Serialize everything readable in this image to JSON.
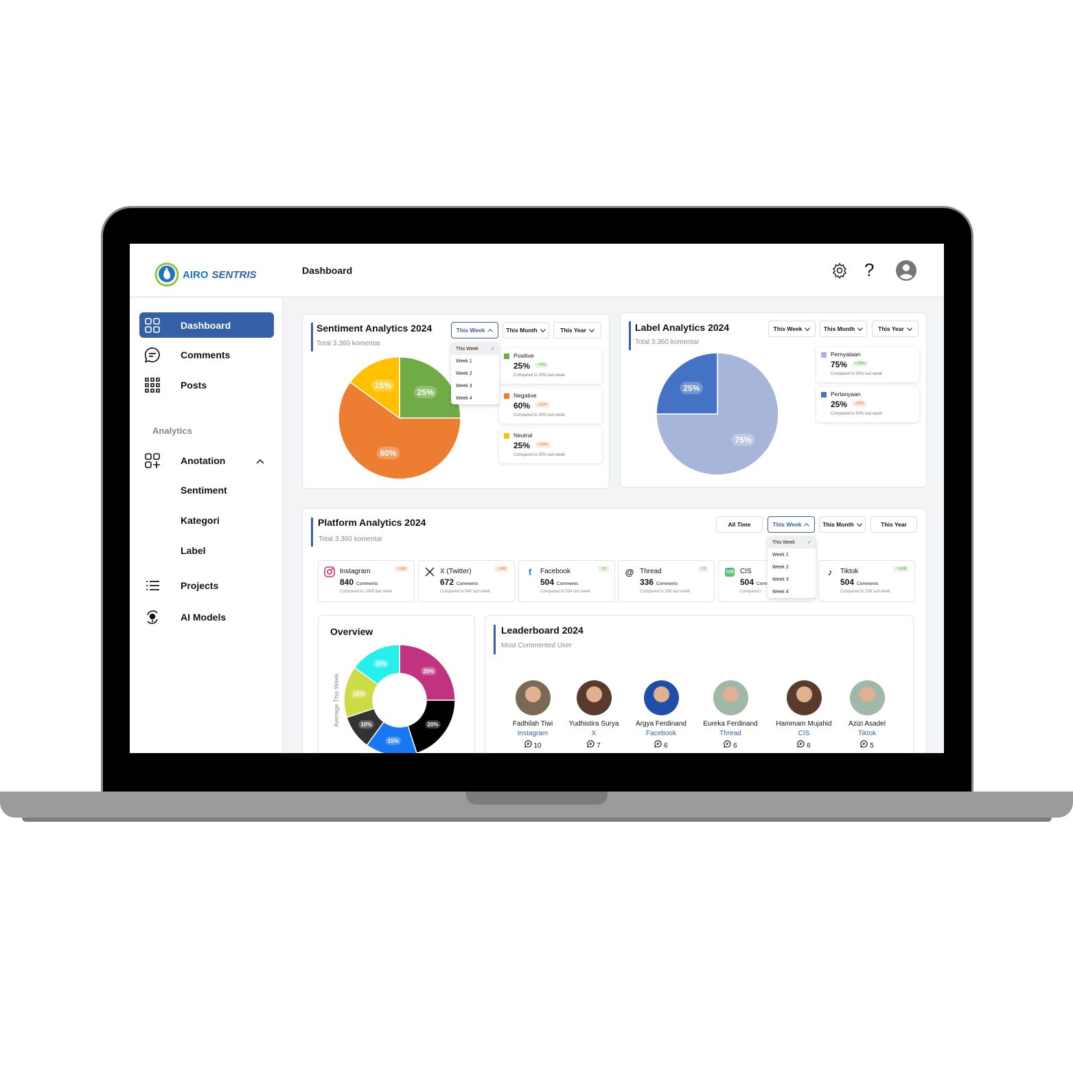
{
  "app": {
    "logo_text_1": "AIRO",
    "logo_text_2": "SENTRIS",
    "page_title": "Dashboard"
  },
  "header": {
    "icons": [
      "gear-icon",
      "help-icon",
      "user-avatar-icon"
    ],
    "help_glyph": "?"
  },
  "sidebar": {
    "items": [
      {
        "label": "Dashboard",
        "icon": "grid-icon",
        "active": true
      },
      {
        "label": "Comments",
        "icon": "chat-icon"
      },
      {
        "label": "Posts",
        "icon": "dots-grid-icon"
      }
    ],
    "section": "Analytics",
    "annotation": {
      "label": "Anotation",
      "icon": "grid-plus-icon",
      "expanded": true,
      "children": [
        "Sentiment",
        "Kategori",
        "Label"
      ]
    },
    "bottom": [
      {
        "label": "Projects",
        "icon": "list-icon"
      },
      {
        "label": "AI Models",
        "icon": "ai-model-icon"
      }
    ]
  },
  "colors": {
    "accent": "#355fa6",
    "positive": "#6fac46",
    "negative": "#ed7d31",
    "neutral": "#ffc000",
    "pernyataan": "#a8b5db",
    "pertanyaan": "#4472c4"
  },
  "sentiment": {
    "title": "Sentiment Analytics 2024",
    "subtitle": "Total 3.360 komentar",
    "filters": [
      "This Week",
      "This Month",
      "This Year"
    ],
    "dropdown": [
      "This Week",
      "Week 1",
      "Week 2",
      "Week 3",
      "Week 4"
    ],
    "check": "✓",
    "stats": [
      {
        "name": "Positive",
        "pct": "25%",
        "delta": "+5%",
        "trend": "up",
        "compare": "Compared to 20% last week"
      },
      {
        "name": "Negative",
        "pct": "60%",
        "delta": "-15%",
        "trend": "down",
        "compare": "Compared to 30% last week"
      },
      {
        "name": "Neutral",
        "pct": "25%",
        "delta": "+10%",
        "trend": "down",
        "compare": "Compared to 50% last week"
      }
    ]
  },
  "label": {
    "title": "Label Analytics 2024",
    "subtitle": "Total 3.360 komentar",
    "filters": [
      "This Week",
      "This Month",
      "This Year"
    ],
    "stats": [
      {
        "name": "Pernyataan",
        "pct": "75%",
        "delta": "+25%",
        "trend": "up",
        "compare": "Compared to 50% last week"
      },
      {
        "name": "Pertanyaan",
        "pct": "25%",
        "delta": "-25%",
        "trend": "down",
        "compare": "Compared to 50% last week"
      }
    ]
  },
  "platform": {
    "title": "Platform Analytics 2024",
    "subtitle": "Total 3.360 komentar",
    "filters": [
      "All Time",
      "This Week",
      "This Month",
      "This Year"
    ],
    "dropdown": [
      "This Week",
      "Week 1",
      "Week 2",
      "Week 3",
      "Week 4"
    ],
    "unit": "Comments",
    "cards": [
      {
        "name": "Instagram",
        "value": "840",
        "delta": "-168",
        "trend": "down",
        "compare": "Compared to 1008 last week",
        "icon": "instagram-icon"
      },
      {
        "name": "X (Twitter)",
        "value": "672",
        "delta": "-168",
        "trend": "down",
        "compare": "Compared to 840 last week",
        "icon": "x-twitter-icon"
      },
      {
        "name": "Facebook",
        "value": "504",
        "delta": "+0",
        "trend": "up",
        "compare": "Compared to 504 last week",
        "icon": "facebook-icon"
      },
      {
        "name": "Thread",
        "value": "336",
        "delta": "+0",
        "trend": "up",
        "compare": "Compared to 336 last week",
        "icon": "threads-icon"
      },
      {
        "name": "CIS",
        "value": "504",
        "delta": "",
        "trend": "up",
        "compare": "Compared t",
        "icon": "cis-icon"
      },
      {
        "name": "Tiktok",
        "value": "504",
        "delta": "+168",
        "trend": "up",
        "compare": "Compared to 336 last week",
        "icon": "tiktok-icon"
      }
    ]
  },
  "chart_data": [
    {
      "type": "pie",
      "categories": [
        "Positive",
        "Negative",
        "Neutral"
      ],
      "values": [
        25,
        60,
        15
      ],
      "labels": [
        "25%",
        "60%",
        "15%"
      ],
      "colors": [
        "#6fac46",
        "#ed7d31",
        "#ffc000"
      ]
    },
    {
      "type": "pie",
      "categories": [
        "Pernyataan",
        "Pertanyaan"
      ],
      "values": [
        75,
        25
      ],
      "labels": [
        "75%",
        "25%"
      ],
      "colors": [
        "#a8b5db",
        "#4472c4"
      ]
    },
    {
      "type": "donut",
      "title": "Overview",
      "ylabel": "Average This Week",
      "values": [
        25,
        20,
        15,
        10,
        15,
        15
      ],
      "labels": [
        "25%",
        "20%",
        "15%",
        "10%",
        "15%",
        "15%"
      ],
      "colors": [
        "#c2337f",
        "#000000",
        "#1877f2",
        "#333333",
        "#cddc46",
        "#27f0ec"
      ]
    }
  ],
  "leaderboard": {
    "title": "Leaderboard 2024",
    "subtitle": "Most Commented User",
    "users": [
      {
        "name": "Fadhilah Tiwi",
        "platform": "Instagram",
        "count": "10"
      },
      {
        "name": "Yudhistira Surya",
        "platform": "X",
        "count": "7"
      },
      {
        "name": "Argya Ferdinand",
        "platform": "Facebook",
        "count": "6"
      },
      {
        "name": "Eureka Ferdinand",
        "platform": "Thread",
        "count": "6"
      },
      {
        "name": "Hammam Mujahid",
        "platform": "CIS",
        "count": "6"
      },
      {
        "name": "Azizi Asadel",
        "platform": "Tiktok",
        "count": "5"
      }
    ]
  }
}
